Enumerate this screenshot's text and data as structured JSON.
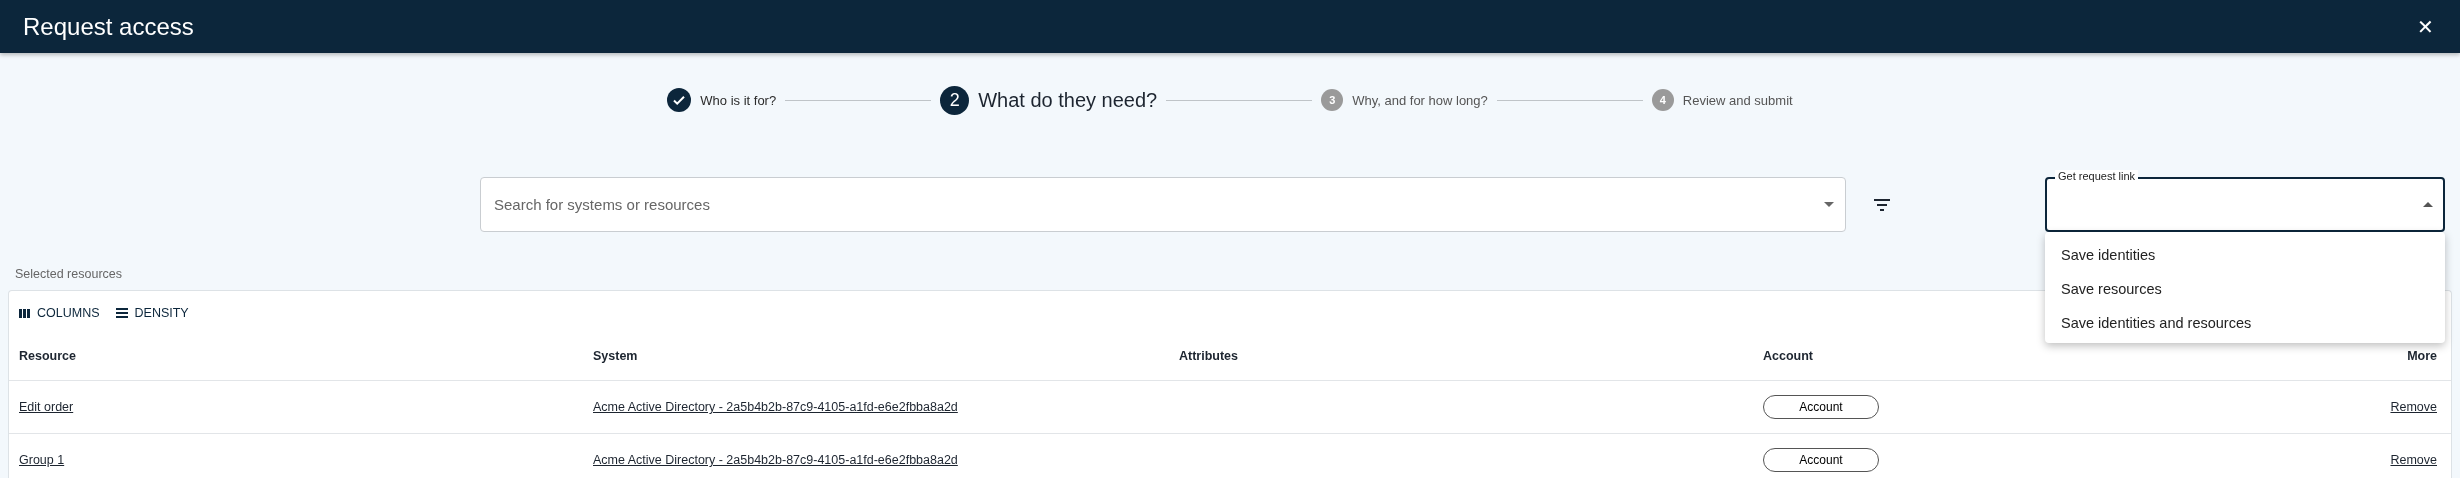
{
  "header": {
    "title": "Request access",
    "close_icon": "✕"
  },
  "steps": [
    {
      "label": "Who is it for?",
      "completed": true,
      "selected": false
    },
    {
      "number": "2",
      "label": "What do they need?",
      "completed": false,
      "selected": true
    },
    {
      "number": "3",
      "label": "Why, and for how long?",
      "completed": false,
      "selected": false
    },
    {
      "number": "4",
      "label": "Review and submit",
      "completed": false,
      "selected": false
    }
  ],
  "search": {
    "placeholder": "Search for systems or resources"
  },
  "request_link": {
    "label": "Get request link",
    "expanded": true,
    "options": [
      "Save identities",
      "Save resources",
      "Save identities and resources"
    ]
  },
  "section_title": "Selected resources",
  "table": {
    "toolbar": [
      {
        "kind": "columns",
        "label": "COLUMNS"
      },
      {
        "kind": "density",
        "label": "DENSITY"
      }
    ],
    "columns": [
      "Resource",
      "System",
      "Attributes",
      "Account",
      "More"
    ],
    "rows": [
      {
        "resource": "Edit order",
        "system": "Acme Active Directory - 2a5b4b2b-87c9-4105-a1fd-e6e2fbba8a2d",
        "account": "Account",
        "action": "Remove"
      },
      {
        "resource": "Group 1",
        "system": "Acme Active Directory - 2a5b4b2b-87c9-4105-a1fd-e6e2fbba8a2d",
        "account": "Account",
        "action": "Remove"
      }
    ]
  }
}
